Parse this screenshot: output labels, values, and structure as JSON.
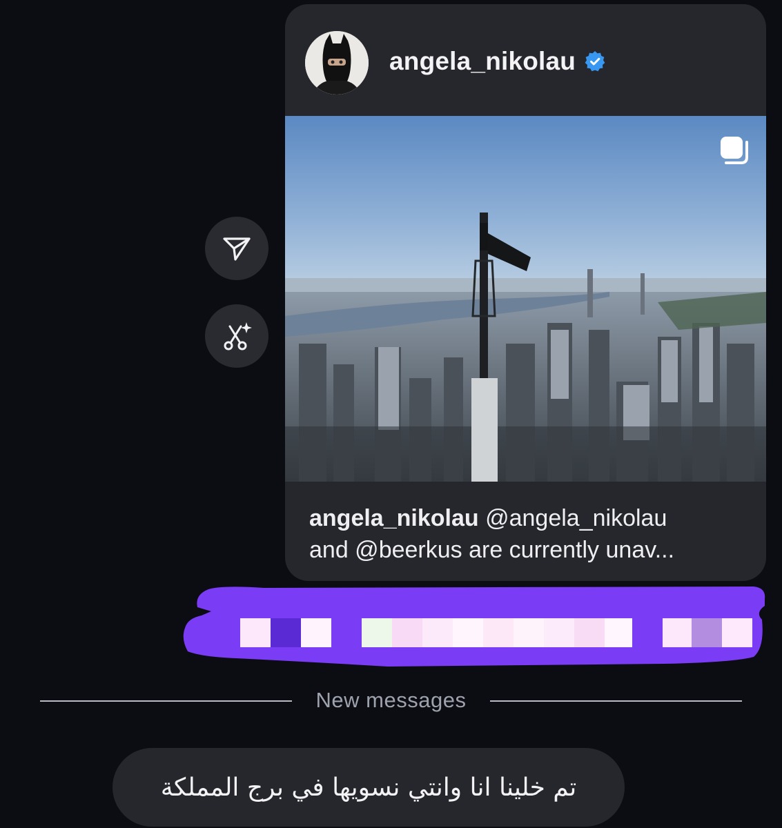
{
  "shared_post": {
    "username": "angela_nikolau",
    "verified": true,
    "caption_user": "angela_nikolau",
    "caption_line1": " @angela_nikolau",
    "caption_line2": "and @beerkus are currently unav..."
  },
  "side_actions": {
    "share_icon": "paper-plane-icon",
    "ai_edit_icon": "scissors-sparkle-icon"
  },
  "sent_message": {
    "status": "redacted",
    "bubble_color": "#7a3cf5"
  },
  "divider": {
    "label": "New messages"
  },
  "incoming_message": {
    "text": "تم خلينا انا وانتي نسويها في برج المملكة"
  },
  "colors": {
    "background": "#0c0d12",
    "bubble": "#26272d",
    "verified_blue": "#3897f0"
  }
}
